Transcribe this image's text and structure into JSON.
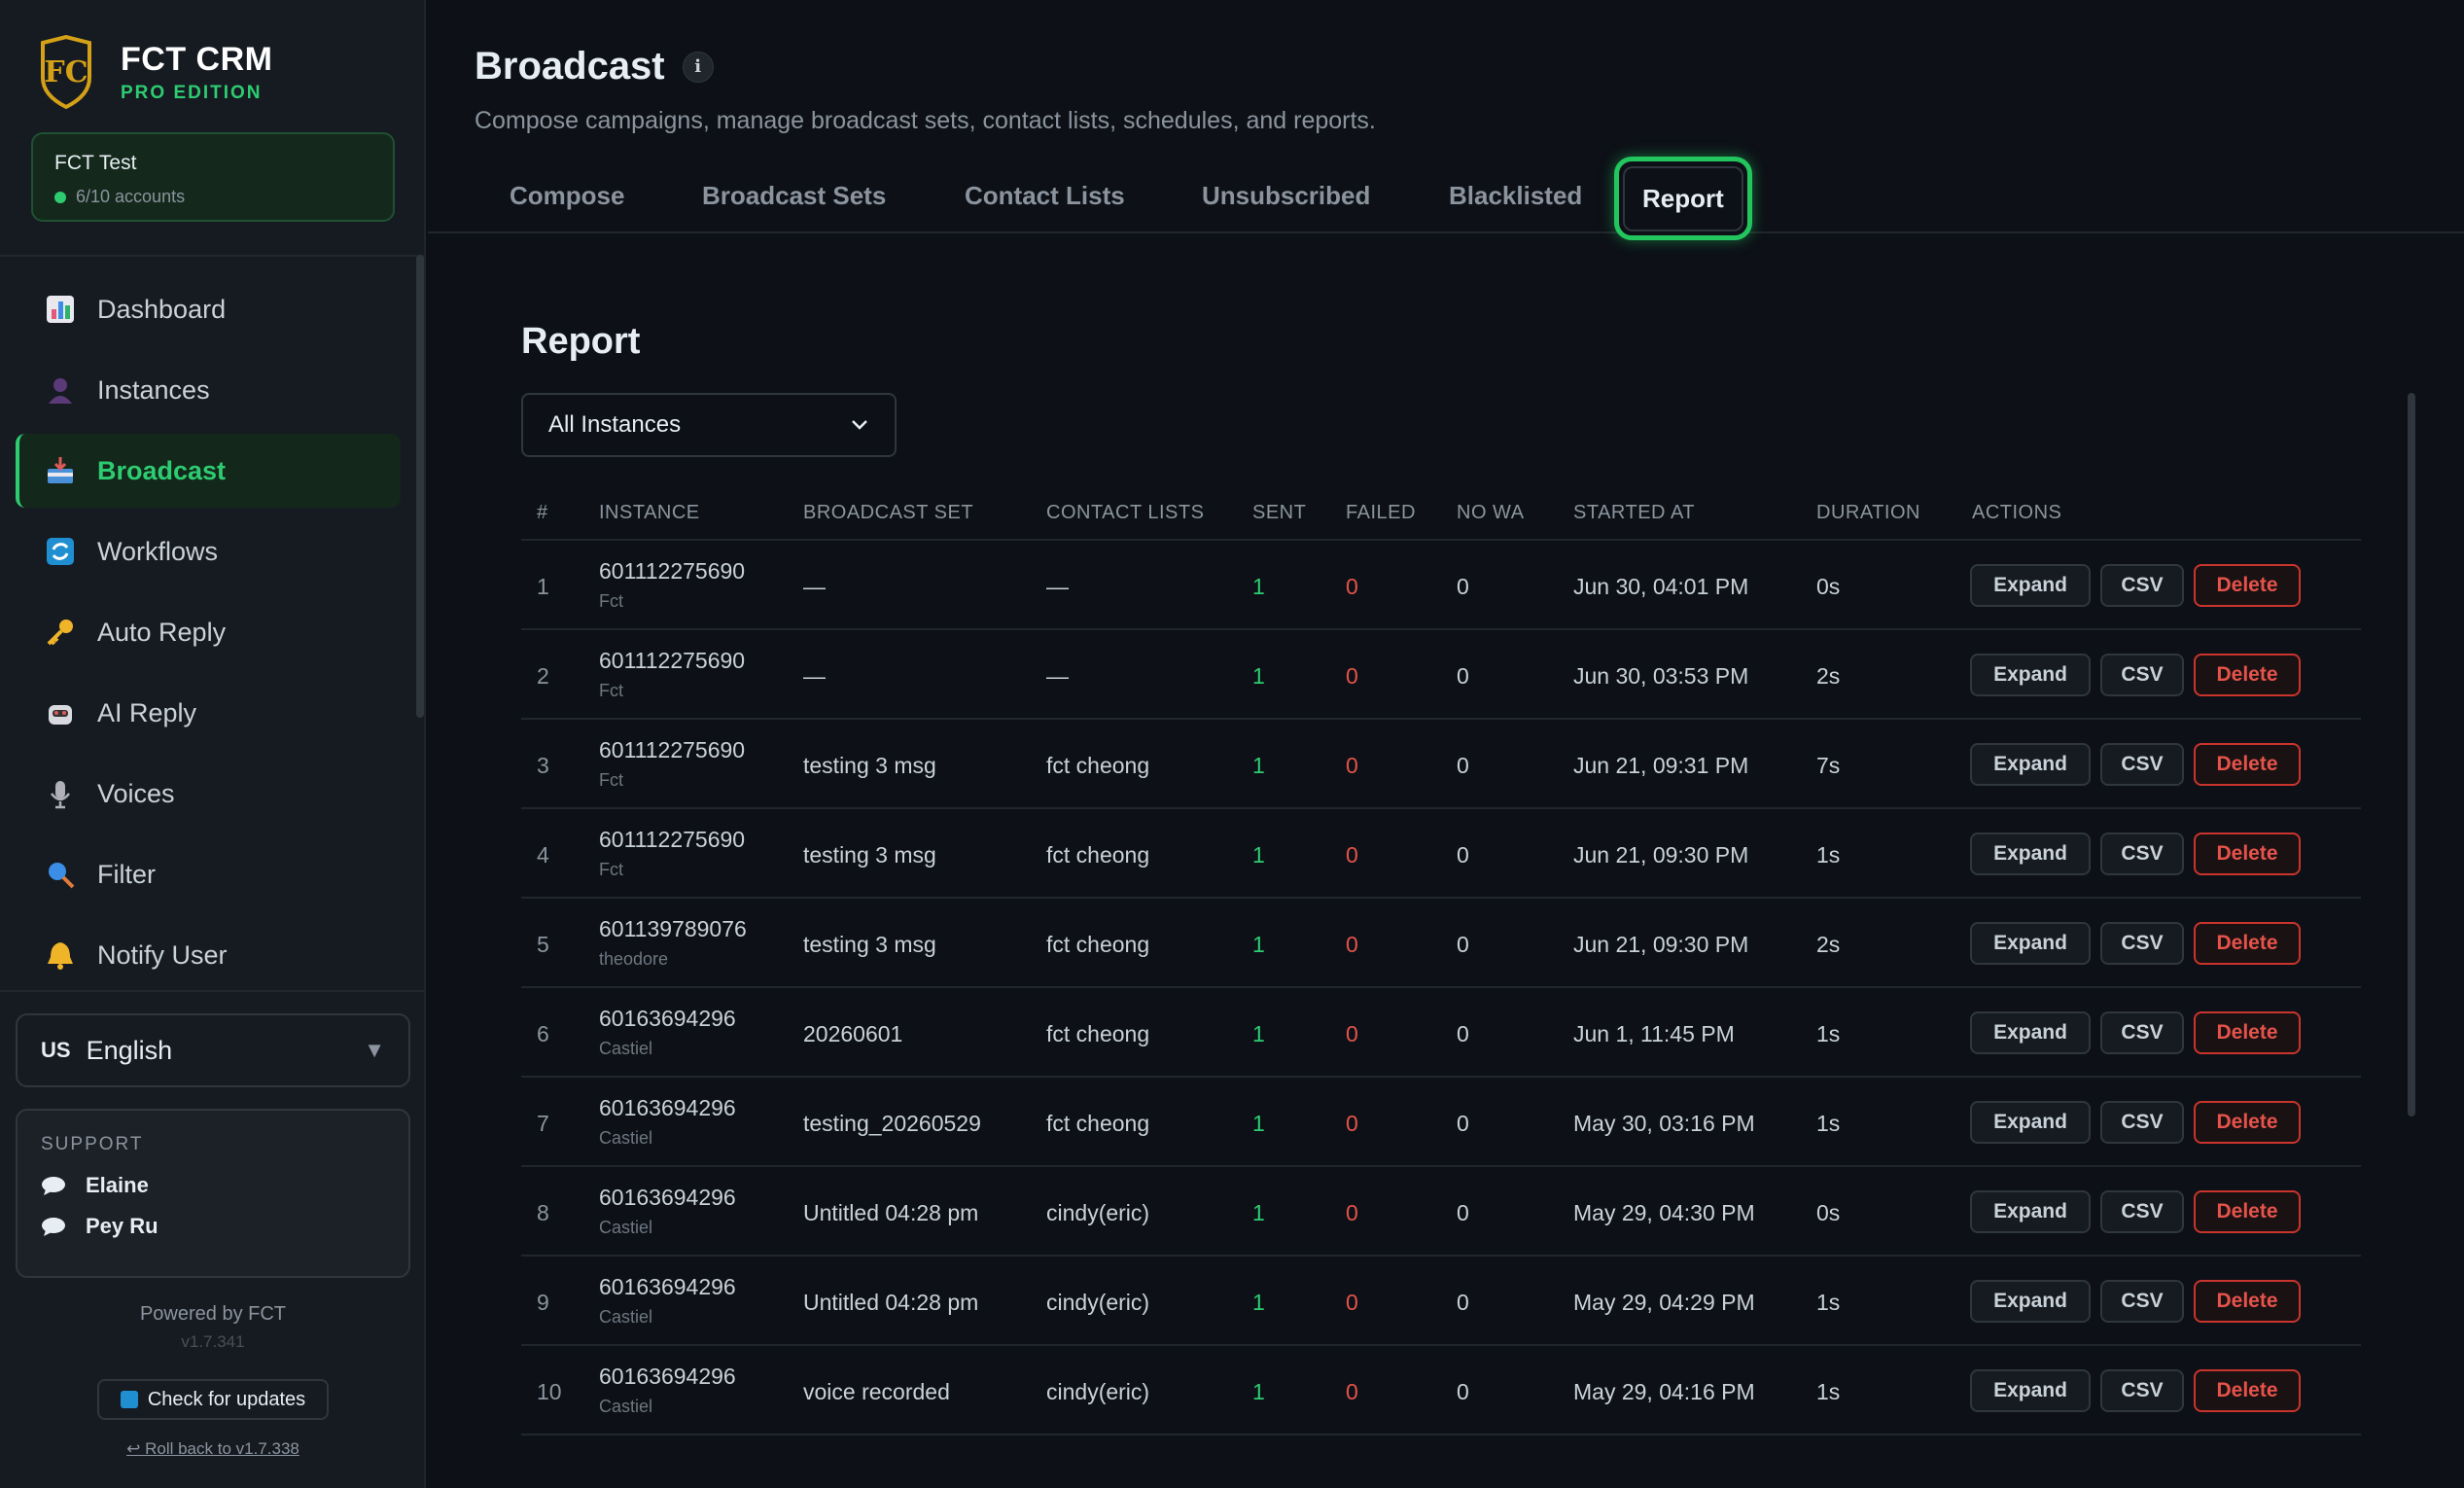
{
  "app": {
    "title": "FCT CRM",
    "edition": "PRO EDITION"
  },
  "account": {
    "name": "FCT Test",
    "count": "6/10 accounts"
  },
  "sidebar": {
    "items": [
      {
        "label": "Dashboard",
        "icon": "bar-chart-icon"
      },
      {
        "label": "Instances",
        "icon": "person-icon"
      },
      {
        "label": "Broadcast",
        "icon": "inbox-tray-icon"
      },
      {
        "label": "Workflows",
        "icon": "refresh-arrows-icon"
      },
      {
        "label": "Auto Reply",
        "icon": "key-icon"
      },
      {
        "label": "AI Reply",
        "icon": "robot-icon"
      },
      {
        "label": "Voices",
        "icon": "microphone-icon"
      },
      {
        "label": "Filter",
        "icon": "magnifier-icon"
      },
      {
        "label": "Notify User",
        "icon": "bell-icon"
      }
    ],
    "active": "Broadcast"
  },
  "language": {
    "flag": "US",
    "label": "English"
  },
  "support": {
    "title": "SUPPORT",
    "contacts": [
      "Elaine",
      "Pey Ru"
    ]
  },
  "footer": {
    "powered": "Powered by FCT",
    "version": "v1.7.341",
    "update_label": "Check for updates",
    "rollback_label": "↩ Roll back to v1.7.338"
  },
  "page": {
    "title": "Broadcast",
    "subtitle": "Compose campaigns, manage broadcast sets, contact lists, schedules, and reports."
  },
  "tabs": [
    "Compose",
    "Broadcast Sets",
    "Contact Lists",
    "Unsubscribed",
    "Blacklisted",
    "Report"
  ],
  "active_tab": "Report",
  "report": {
    "title": "Report",
    "filter_value": "All Instances",
    "columns": [
      "#",
      "INSTANCE",
      "BROADCAST SET",
      "CONTACT LISTS",
      "SENT",
      "FAILED",
      "NO WA",
      "STARTED AT",
      "DURATION",
      "ACTIONS"
    ],
    "actions": {
      "expand": "Expand",
      "csv": "CSV",
      "delete": "Delete"
    },
    "rows": [
      {
        "n": "1",
        "instance": "601112275690",
        "name": "Fct",
        "set": "—",
        "lists": "—",
        "sent": "1",
        "failed": "0",
        "nowa": "0",
        "started": "Jun 30, 04:01 PM",
        "duration": "0s"
      },
      {
        "n": "2",
        "instance": "601112275690",
        "name": "Fct",
        "set": "—",
        "lists": "—",
        "sent": "1",
        "failed": "0",
        "nowa": "0",
        "started": "Jun 30, 03:53 PM",
        "duration": "2s"
      },
      {
        "n": "3",
        "instance": "601112275690",
        "name": "Fct",
        "set": "testing 3 msg",
        "lists": "fct cheong",
        "sent": "1",
        "failed": "0",
        "nowa": "0",
        "started": "Jun 21, 09:31 PM",
        "duration": "7s"
      },
      {
        "n": "4",
        "instance": "601112275690",
        "name": "Fct",
        "set": "testing 3 msg",
        "lists": "fct cheong",
        "sent": "1",
        "failed": "0",
        "nowa": "0",
        "started": "Jun 21, 09:30 PM",
        "duration": "1s"
      },
      {
        "n": "5",
        "instance": "601139789076",
        "name": "theodore",
        "set": "testing 3 msg",
        "lists": "fct cheong",
        "sent": "1",
        "failed": "0",
        "nowa": "0",
        "started": "Jun 21, 09:30 PM",
        "duration": "2s"
      },
      {
        "n": "6",
        "instance": "60163694296",
        "name": "Castiel",
        "set": "20260601",
        "lists": "fct cheong",
        "sent": "1",
        "failed": "0",
        "nowa": "0",
        "started": "Jun 1, 11:45 PM",
        "duration": "1s"
      },
      {
        "n": "7",
        "instance": "60163694296",
        "name": "Castiel",
        "set": "testing_20260529",
        "lists": "fct cheong",
        "sent": "1",
        "failed": "0",
        "nowa": "0",
        "started": "May 30, 03:16 PM",
        "duration": "1s"
      },
      {
        "n": "8",
        "instance": "60163694296",
        "name": "Castiel",
        "set": "Untitled 04:28 pm",
        "lists": "cindy(eric)",
        "sent": "1",
        "failed": "0",
        "nowa": "0",
        "started": "May 29, 04:30 PM",
        "duration": "0s"
      },
      {
        "n": "9",
        "instance": "60163694296",
        "name": "Castiel",
        "set": "Untitled 04:28 pm",
        "lists": "cindy(eric)",
        "sent": "1",
        "failed": "0",
        "nowa": "0",
        "started": "May 29, 04:29 PM",
        "duration": "1s"
      },
      {
        "n": "10",
        "instance": "60163694296",
        "name": "Castiel",
        "set": "voice recorded",
        "lists": "cindy(eric)",
        "sent": "1",
        "failed": "0",
        "nowa": "0",
        "started": "May 29, 04:16 PM",
        "duration": "1s"
      }
    ]
  },
  "colors": {
    "accent": "#2ecc71",
    "danger": "#e5534b",
    "background": "#0d1117",
    "sidebar": "#161b22"
  }
}
